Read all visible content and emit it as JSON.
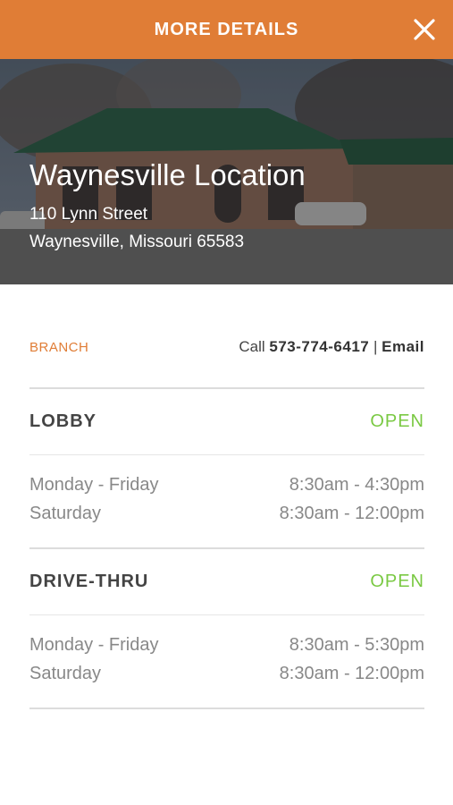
{
  "header": {
    "title": "MORE DETAILS",
    "close_icon": "close-icon"
  },
  "location": {
    "name": "Waynesville Location",
    "street": "110 Lynn Street",
    "city_line": "Waynesville, Missouri 65583"
  },
  "contact": {
    "branch_label": "BRANCH",
    "call_prefix": "Call",
    "phone": "573-774-6417",
    "separator": "|",
    "email_label": "Email"
  },
  "sections": [
    {
      "name": "LOBBY",
      "status": "OPEN",
      "hours": [
        {
          "days": "Monday - Friday",
          "time": "8:30am - 4:30pm"
        },
        {
          "days": "Saturday",
          "time": "8:30am - 12:00pm"
        }
      ]
    },
    {
      "name": "DRIVE-THRU",
      "status": "OPEN",
      "hours": [
        {
          "days": "Monday - Friday",
          "time": "8:30am - 5:30pm"
        },
        {
          "days": "Saturday",
          "time": "8:30am - 12:00pm"
        }
      ]
    }
  ],
  "colors": {
    "accent": "#e07d36",
    "open": "#7ac943"
  }
}
